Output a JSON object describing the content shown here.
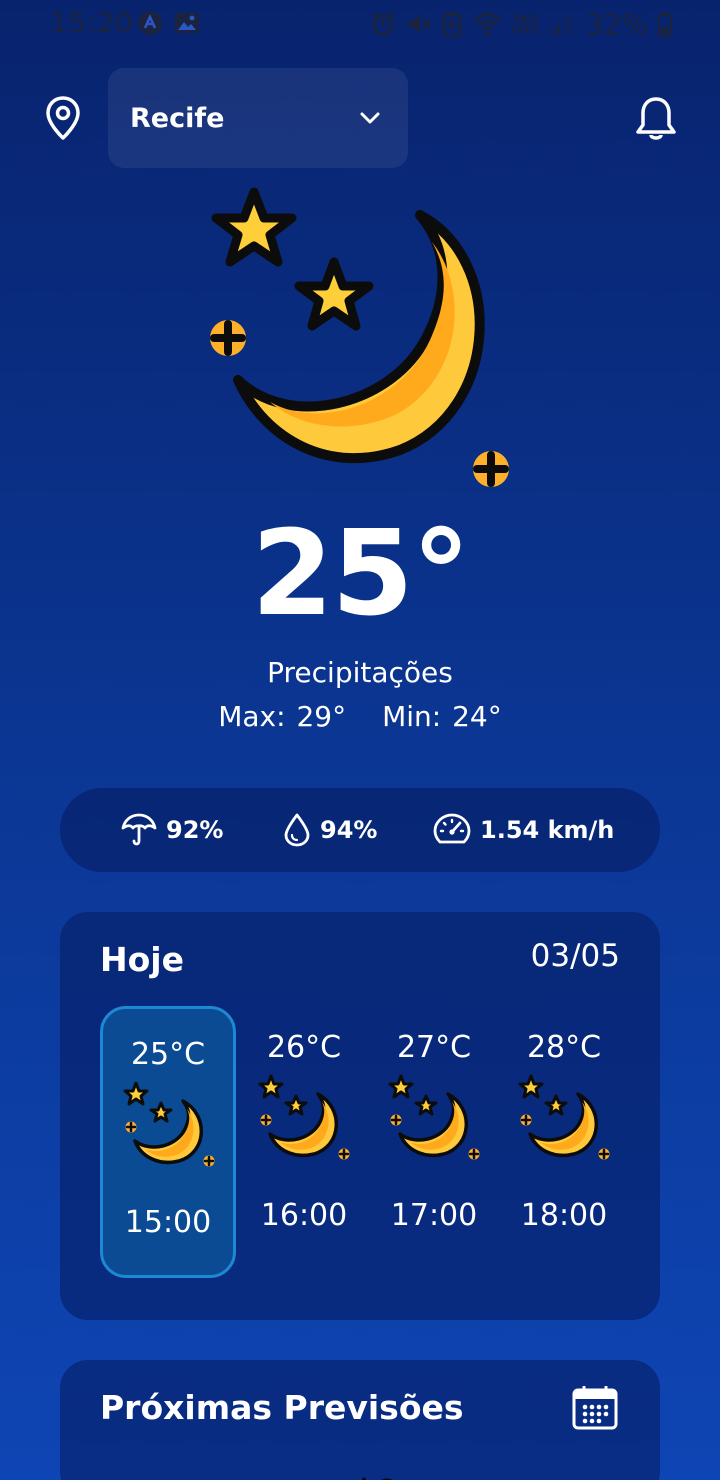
{
  "status_bar": {
    "time": "15:20",
    "battery": "32%",
    "icons": [
      "app-icon",
      "gallery-icon",
      "alarm-icon",
      "mute-icon",
      "battery-saver-icon",
      "wifi-icon",
      "volte-icon",
      "signal-icon",
      "battery-icon"
    ],
    "network_label_top": "Vo))",
    "network_label_bottom": "LTE1"
  },
  "header": {
    "city": "Recife",
    "location_icon": "location-pin-icon",
    "dropdown_icon": "chevron-down-icon",
    "notifications_icon": "bell-icon"
  },
  "current": {
    "icon": "moon-stars-icon",
    "temperature": "25°",
    "condition": "Precipitações",
    "max_label": "Max: 29°",
    "min_label": "Min: 24°"
  },
  "stats": {
    "precipitation": "92%",
    "humidity": "94%",
    "wind": "1.54 km/h",
    "icons": [
      "umbrella-icon",
      "drop-icon",
      "speedometer-icon"
    ]
  },
  "today": {
    "title": "Hoje",
    "date": "03/05",
    "hours": [
      {
        "temp": "25°C",
        "time": "15:00",
        "selected": true
      },
      {
        "temp": "26°C",
        "time": "16:00",
        "selected": false
      },
      {
        "temp": "27°C",
        "time": "17:00",
        "selected": false
      },
      {
        "temp": "28°C",
        "time": "18:00",
        "selected": false
      }
    ]
  },
  "next": {
    "title": "Próximas Previsões",
    "icon": "calendar-icon"
  },
  "colors": {
    "bg_top": "#08236e",
    "bg_bottom": "#0e45b4",
    "card": "#0a2468",
    "selected_fill": "#0a4b94",
    "selected_border": "#1e88d2",
    "moon": "#ffc93c",
    "star": "#ffcf3a"
  }
}
